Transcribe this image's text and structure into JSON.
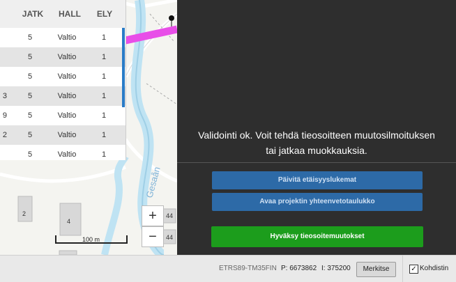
{
  "table": {
    "headers": [
      "JATK",
      "HALL",
      "ELY"
    ],
    "rows": [
      {
        "partial": "",
        "jatk": "5",
        "hall": "Valtio",
        "ely": "1"
      },
      {
        "partial": "",
        "jatk": "5",
        "hall": "Valtio",
        "ely": "1"
      },
      {
        "partial": "",
        "jatk": "5",
        "hall": "Valtio",
        "ely": "1"
      },
      {
        "partial": "3",
        "jatk": "5",
        "hall": "Valtio",
        "ely": "1"
      },
      {
        "partial": "9",
        "jatk": "5",
        "hall": "Valtio",
        "ely": "1"
      },
      {
        "partial": "2",
        "jatk": "5",
        "hall": "Valtio",
        "ely": "1"
      },
      {
        "partial": "",
        "jatk": "5",
        "hall": "Valtio",
        "ely": "1"
      }
    ]
  },
  "map": {
    "zoom_in": "+",
    "zoom_out": "−",
    "scale_label": "100 m",
    "river_label": "Gesaån",
    "building_labels": [
      "2",
      "4",
      "44",
      "44"
    ]
  },
  "panel": {
    "message_line1": "Validointi ok. Voit tehdä tieosoitteen muutosilmoituksen",
    "message_line2": "tai jatkaa muokkauksia.",
    "btn_update_distances": "Päivitä etäisyyslukemat",
    "btn_open_summary": "Avaa projektin yhteenvetotaulukko",
    "btn_accept": "Hyväksy tieosoitemuutokset"
  },
  "footer": {
    "coord_system": "ETRS89-TM35FIN",
    "p_coord": "P: 6673862",
    "i_coord": "I: 375200",
    "mark_button": "Merkitse",
    "crosshair_label": "Kohdistin",
    "crosshair_checked": "✓"
  },
  "colors": {
    "panel_bg": "#2e2e2e",
    "blue_button": "#2d6aa7",
    "green_button": "#1c9d1c",
    "selected_road": "#e84ee8",
    "river": "#bfe3f3"
  }
}
